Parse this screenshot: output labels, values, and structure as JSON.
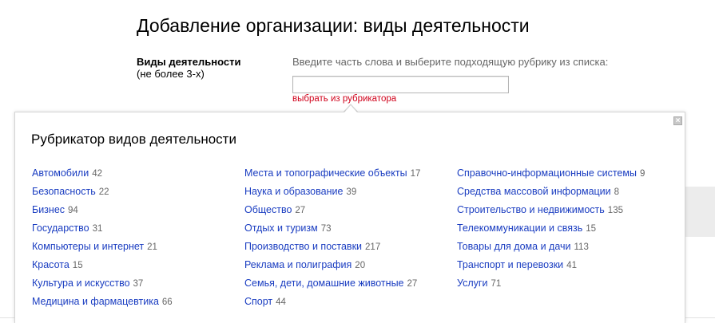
{
  "title": "Добавление организации: виды деятельности",
  "field": {
    "label": "Виды деятельности",
    "hint": "(не более 3-х)",
    "instructions": "Введите часть слова и выберите подходящую рубрику из списка:",
    "input_value": "",
    "catalog_link": "выбрать из рубрикатора"
  },
  "popup": {
    "title": "Рубрикатор видов деятельности",
    "close_icon": "×",
    "columns": [
      [
        {
          "name": "Автомобили",
          "count": "42"
        },
        {
          "name": "Безопасность",
          "count": "22"
        },
        {
          "name": "Бизнес",
          "count": "94"
        },
        {
          "name": "Государство",
          "count": "31"
        },
        {
          "name": "Компьютеры и интернет",
          "count": "21"
        },
        {
          "name": "Красота",
          "count": "15"
        },
        {
          "name": "Культура и искусство",
          "count": "37"
        },
        {
          "name": "Медицина и фармацевтика",
          "count": "66"
        }
      ],
      [
        {
          "name": "Места и топографические объекты",
          "count": "17"
        },
        {
          "name": "Наука и образование",
          "count": "39"
        },
        {
          "name": "Общество",
          "count": "27"
        },
        {
          "name": "Отдых и туризм",
          "count": "73"
        },
        {
          "name": "Производство и поставки",
          "count": "217"
        },
        {
          "name": "Реклама и полиграфия",
          "count": "20"
        },
        {
          "name": "Семья, дети, домашние животные",
          "count": "27"
        },
        {
          "name": "Спорт",
          "count": "44"
        }
      ],
      [
        {
          "name": "Справочно-информационные системы",
          "count": "9"
        },
        {
          "name": "Средства массовой информации",
          "count": "8"
        },
        {
          "name": "Строительство и недвижимость",
          "count": "135"
        },
        {
          "name": "Телекоммуникации и связь",
          "count": "15"
        },
        {
          "name": "Товары для дома и дачи",
          "count": "113"
        },
        {
          "name": "Транспорт и перевозки",
          "count": "41"
        },
        {
          "name": "Услуги",
          "count": "71"
        }
      ]
    ]
  }
}
